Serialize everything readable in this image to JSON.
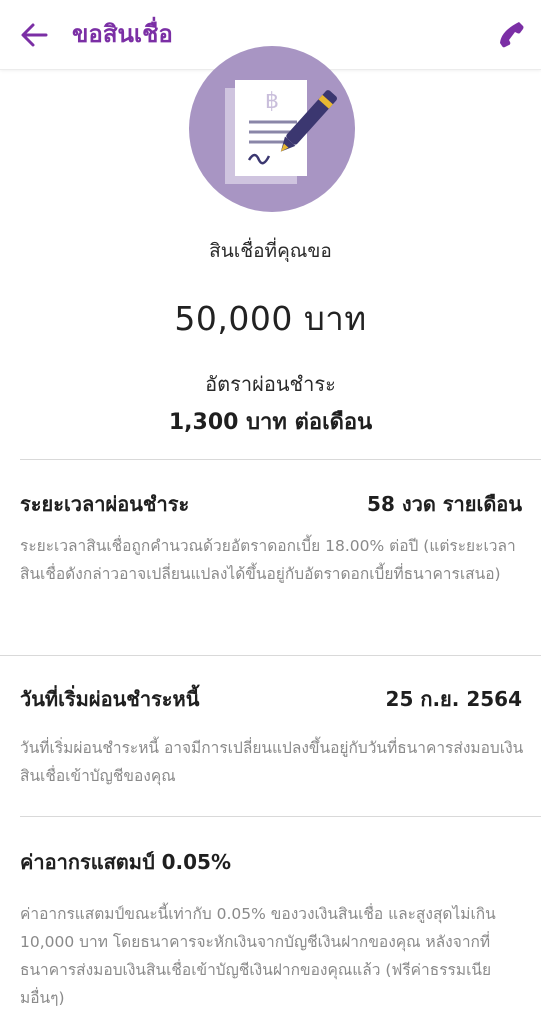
{
  "header": {
    "title": "ขอสินเชื่อ",
    "back_icon": "arrow-left-icon",
    "call_icon": "phone-icon",
    "accent_color": "#7b2fa5"
  },
  "summary": {
    "loan_label": "สินเชื่อที่คุณขอ",
    "loan_amount": "50,000 บาท",
    "rate_label": "อัตราผ่อนชำระ",
    "rate_value": "1,300 บาท ต่อเดือน",
    "illustration": "loan-document-signing-icon"
  },
  "sections": [
    {
      "title": "ระยะเวลาผ่อนชำระ",
      "value": "58 งวด รายเดือน",
      "description": "ระยะเวลาสินเชื่อถูกคำนวณด้วยอัตราดอกเบี้ย 18.00% ต่อปี (แต่ระยะเวลาสินเชื่อดังกล่าวอาจเปลี่ยนแปลงได้ขึ้นอยู่กับอัตราดอกเบี้ยที่ธนาคารเสนอ)"
    },
    {
      "title": "วันที่เริ่มผ่อนชำระหนี้",
      "value": "25 ก.ย. 2564",
      "description": "วันที่เริ่มผ่อนชำระหนี้ อาจมีการเปลี่ยนแปลงขึ้นอยู่กับวันที่ธนาคารส่งมอบเงินสินเชื่อเข้าบัญชีของคุณ"
    },
    {
      "title": "ค่าอากรแสตมป์ 0.05%",
      "value": "",
      "description": "ค่าอากรแสตมป์ขณะนี้เท่ากับ 0.05% ของวงเงินสินเชื่อ และสูงสุดไม่เกิน 10,000 บาท โดยธนาคารจะหักเงินจากบัญชีเงินฝากของคุณ หลังจากที่ธนาคารส่งมอบเงินสินเชื่อเข้าบัญชีเงินฝากของคุณแล้ว (ฟรีค่าธรรมเนียมอื่นๆ)"
    }
  ]
}
